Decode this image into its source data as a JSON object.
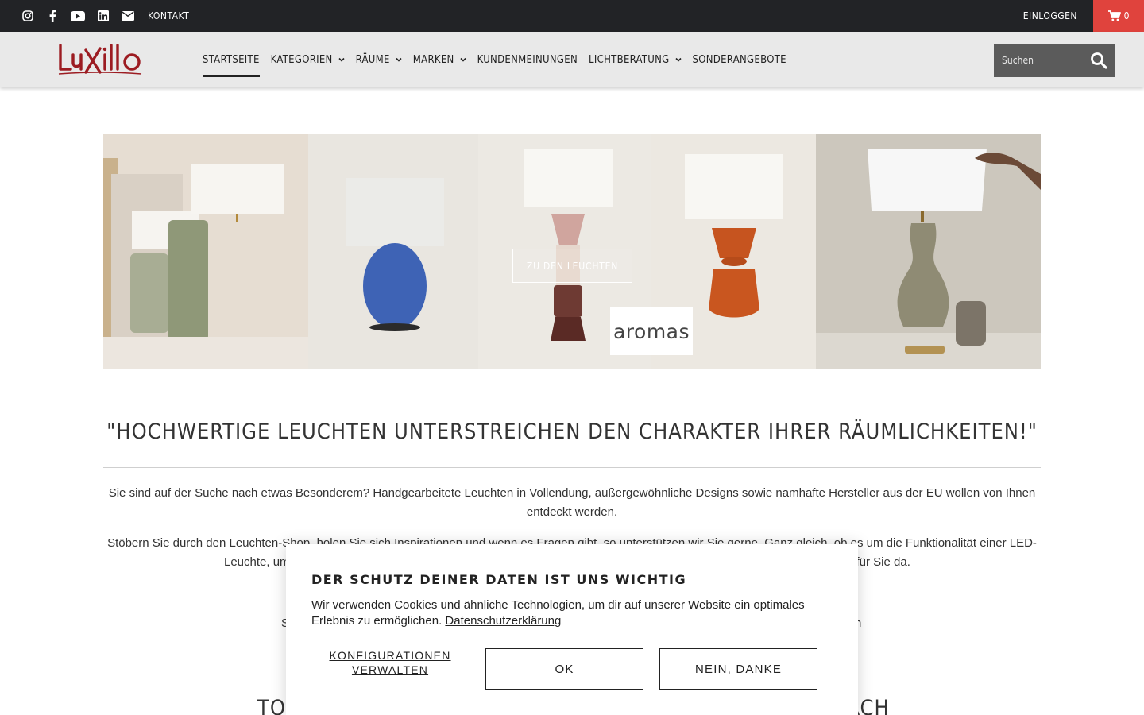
{
  "topbar": {
    "social_icons": [
      "instagram-icon",
      "facebook-icon",
      "youtube-icon",
      "linkedin-icon",
      "mail-icon"
    ],
    "contact_label": "KONTAKT",
    "login_label": "EINLOGGEN",
    "cart_count": "0",
    "cart_color": "#e0433d"
  },
  "header": {
    "logo_text": "LuXillo",
    "nav": [
      {
        "label": "STARTSEITE",
        "dropdown": false,
        "active": true
      },
      {
        "label": "KATEGORIEN",
        "dropdown": true
      },
      {
        "label": "RÄUME",
        "dropdown": true
      },
      {
        "label": "MARKEN",
        "dropdown": true
      },
      {
        "label": "KUNDENMEINUNGEN",
        "dropdown": false
      },
      {
        "label": "LICHTBERATUNG",
        "dropdown": true
      },
      {
        "label": "SONDERANGEBOTE",
        "dropdown": false
      }
    ],
    "search_placeholder": "Suchen"
  },
  "hero": {
    "cta_label": "ZU DEN LEUCHTEN",
    "brand_label": "aromas"
  },
  "content": {
    "quote": "\"HOCHWERTIGE LEUCHTEN UNTERSTREICHEN DEN CHARAKTER IHRER RÄUMLICHKEITEN!\"",
    "para1": "Sie sind auf der Suche nach etwas Besonderem? Handgearbeitete Leuchten in Vollendung, außergewöhnliche Designs sowie namhafte Hersteller aus der EU wollen von Ihnen entdeckt werden.",
    "para2_line1_left": "Stöbern Sie durch den Leuchten-Shop, holen Sie sich Inspirationen und wenn es Fragen gibt, so unterstützen wir Sie gerne. Ganz gleich, ob es um die Funktionalität einer LED-",
    "para2_line2_left": "Leuchte, um",
    "para2_line2_right": "d für Sie da.",
    "partial_left": "S",
    "partial_right": "n",
    "bottom_left": "TOP",
    "bottom_right": "RCH"
  },
  "cookie": {
    "title": "DER SCHUTZ DEINER DATEN IST UNS WICHTIG",
    "text": "Wir verwenden Cookies und ähnliche Technologien, um dir auf unserer Website ein optimales Erlebnis zu ermöglichen.",
    "privacy_link": "Datenschutzerklärung",
    "config_label": "KONFIGURATIONEN VERWALTEN",
    "ok_label": "OK",
    "no_label": "NEIN, DANKE"
  }
}
